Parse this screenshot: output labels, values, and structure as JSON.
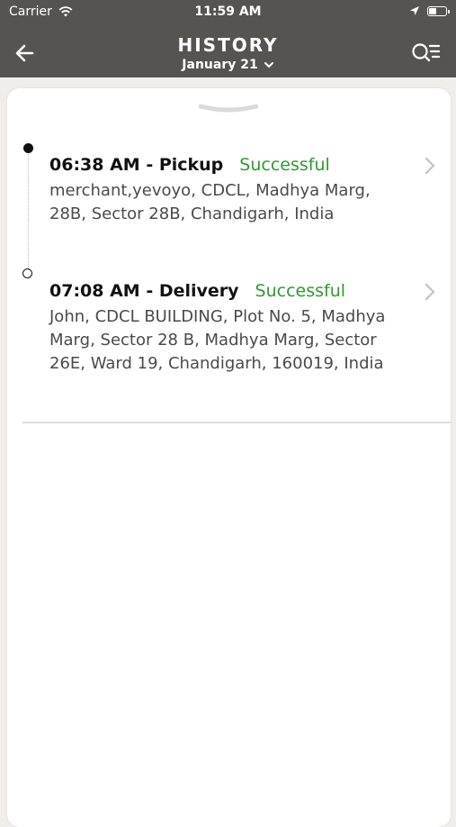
{
  "status_bar": {
    "carrier": "Carrier",
    "time": "11:59 AM",
    "icons": [
      "wifi-icon",
      "location-arrow-icon",
      "battery-icon"
    ]
  },
  "header": {
    "title": "HISTORY",
    "date_label": "January 21",
    "back_icon": "arrow-left-icon",
    "filter_icon": "search-list-icon",
    "background_color": "#555450"
  },
  "events": [
    {
      "time_type": "06:38 AM - Pickup",
      "status": "Successful",
      "address": "merchant,yevoyo, CDCL, Madhya Marg, 28B, Sector 28B, Chandigarh, India"
    },
    {
      "time_type": "07:08 AM - Delivery",
      "status": "Successful",
      "address": "John, CDCL BUILDING, Plot No. 5, Madhya Marg, Sector 28 B, Madhya Marg, Sector 26E, Ward 19, Chandigarh, 160019, India"
    }
  ],
  "colors": {
    "success": "#2f9a2f",
    "header": "#555450"
  }
}
